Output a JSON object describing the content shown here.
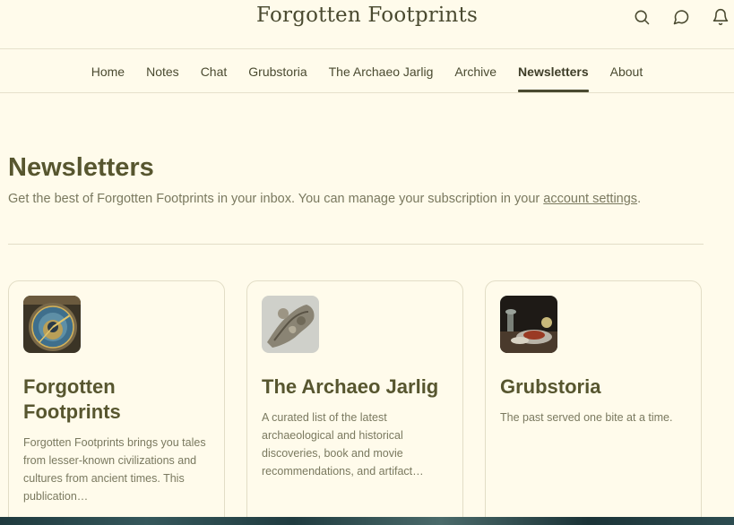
{
  "header": {
    "title": "Forgotten Footprints",
    "icons": [
      "search-icon",
      "chat-bubble-icon",
      "bell-icon"
    ]
  },
  "nav": {
    "items": [
      {
        "label": "Home"
      },
      {
        "label": "Notes"
      },
      {
        "label": "Chat"
      },
      {
        "label": "Grubstoria"
      },
      {
        "label": "The Archaeo Jarlig"
      },
      {
        "label": "Archive"
      },
      {
        "label": "Newsletters",
        "active": true
      },
      {
        "label": "About"
      }
    ]
  },
  "page": {
    "heading": "Newsletters",
    "subtitle_prefix": "Get the best of Forgotten Footprints in your inbox. You can manage your subscription in your ",
    "subtitle_link": "account settings",
    "subtitle_suffix": "."
  },
  "cards": [
    {
      "name": "Forgotten Footprints",
      "description": "Forgotten Footprints brings you tales from lesser-known civilizations and cultures from ancient times. This publication…",
      "thumb": "astronomical-clock-image"
    },
    {
      "name": "The Archaeo Jarlig",
      "description": "A curated list of the latest archaeological and historical discoveries, book and movie recommendations, and artifact…",
      "thumb": "silver-artifact-image"
    },
    {
      "name": "Grubstoria",
      "description": "The past served one bite at a time.",
      "thumb": "still-life-painting-image"
    }
  ],
  "colors": {
    "background": "#fffbeb",
    "text": "#4a4a30",
    "muted": "#7a795f",
    "border": "#e2ddc6"
  }
}
